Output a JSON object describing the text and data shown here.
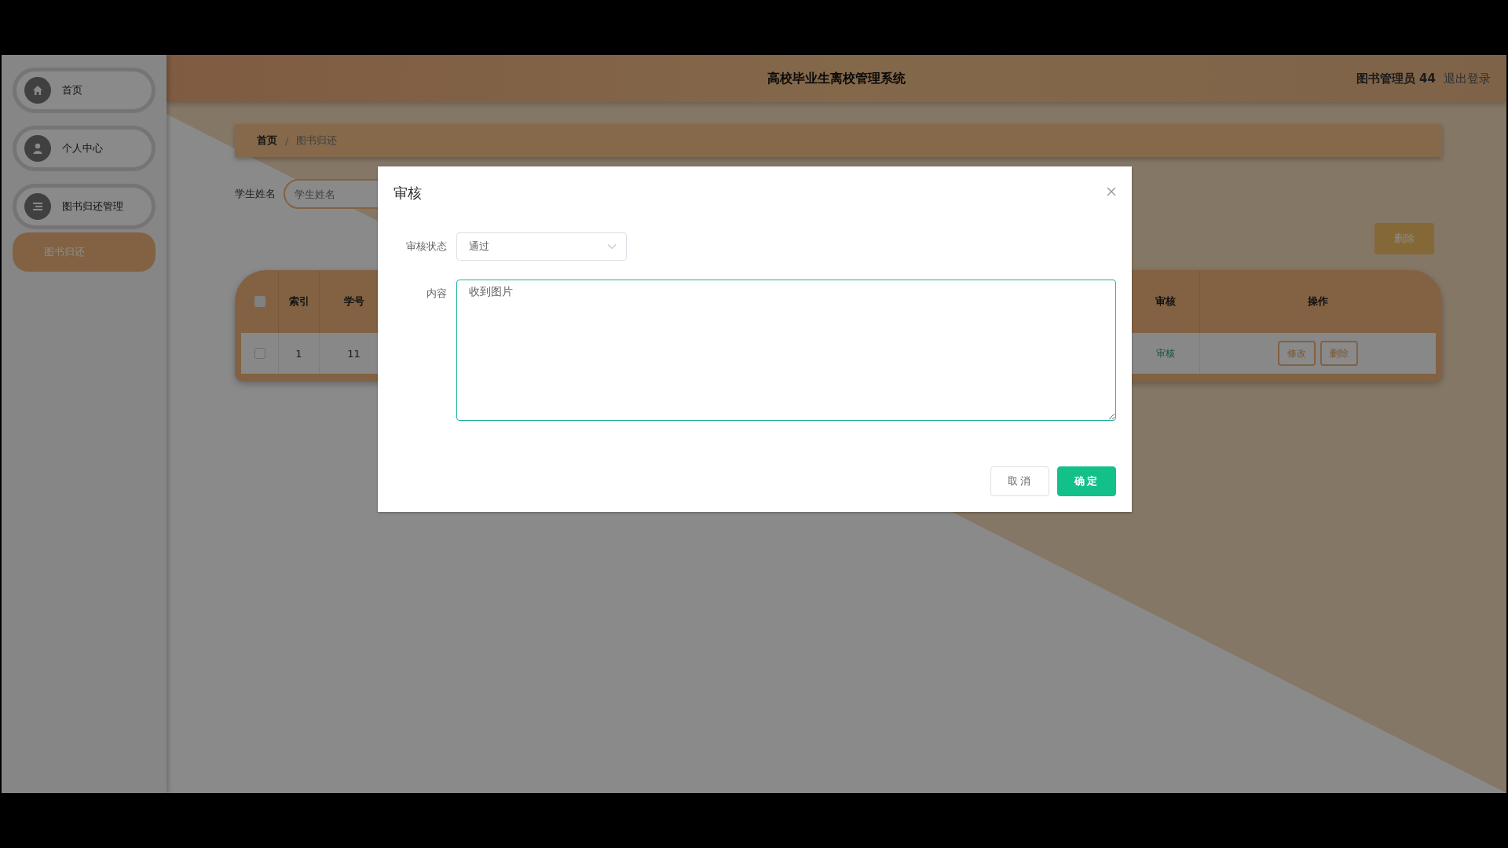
{
  "header": {
    "title": "高校毕业生离校管理系统",
    "user": "图书管理员 44",
    "logout": "退出登录"
  },
  "sidebar": {
    "items": [
      {
        "label": "首页",
        "selected": false
      },
      {
        "label": "个人中心",
        "selected": false
      },
      {
        "label": "图书归还管理",
        "selected": false,
        "children": [
          {
            "label": "图书归还",
            "selected": true
          }
        ]
      }
    ]
  },
  "breadcrumb": {
    "separator": "/",
    "items": [
      "首页",
      "图书归还"
    ]
  },
  "search": {
    "label": "学生姓名",
    "placeholder": "学生姓名"
  },
  "delete_button": "删除",
  "table": {
    "select_all_checked": false,
    "columns_left": [
      "索引",
      "学号"
    ],
    "columns_right": [
      "审核",
      "操作"
    ],
    "rows": [
      {
        "checked": false,
        "cells": [
          "1",
          "11"
        ],
        "review": "审核",
        "actions": [
          "修改",
          "删除"
        ]
      }
    ]
  },
  "dialog": {
    "title": "审核",
    "fields": [
      {
        "kind": "select",
        "label": "审核状态",
        "value": "通过"
      },
      {
        "kind": "textarea",
        "label": "内容",
        "value": "收到图片",
        "focused": true
      }
    ],
    "buttons": [
      {
        "kind": "default",
        "label": "取消"
      },
      {
        "kind": "primary",
        "label": "确定"
      }
    ]
  }
}
